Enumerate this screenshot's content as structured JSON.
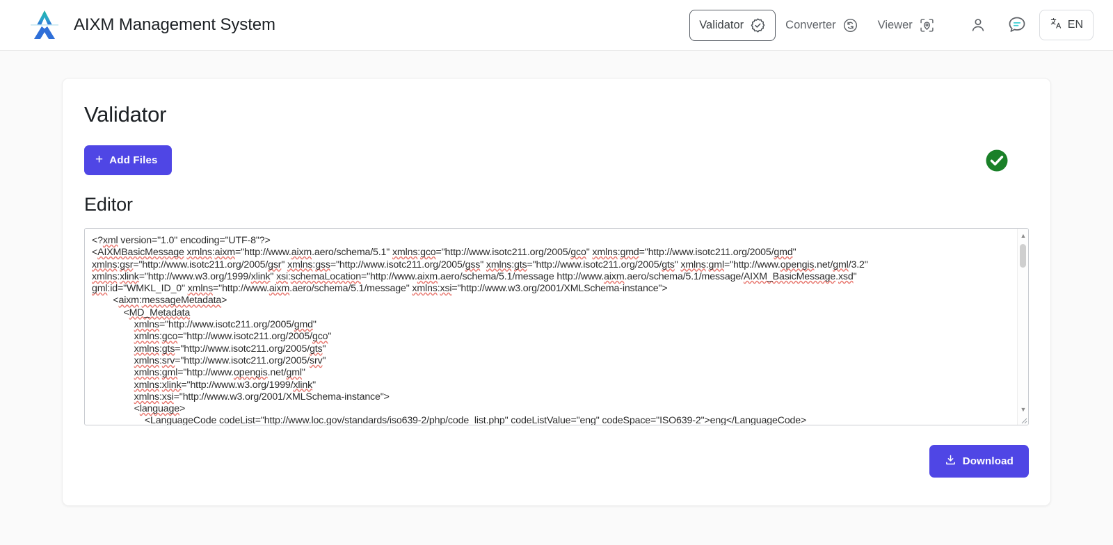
{
  "header": {
    "logo_icon": "aixm-logo-icon",
    "title": "AIXM Management System",
    "nav": [
      {
        "label": "Validator",
        "icon": "badge-check-icon",
        "active": true
      },
      {
        "label": "Converter",
        "icon": "refresh-circle-icon",
        "active": false
      },
      {
        "label": "Viewer",
        "icon": "map-pin-scan-icon",
        "active": false
      }
    ],
    "account_icon": "user-account-icon",
    "chat_icon": "chat-bubble-icon",
    "language": {
      "icon": "translate-icon",
      "label": "EN"
    }
  },
  "main": {
    "page_title": "Validator",
    "add_files_label": "Add Files",
    "add_files_icon": "plus-icon",
    "status_icon": "validation-success-check-icon",
    "status_color": "#1a8028",
    "editor_section_title": "Editor",
    "download_label": "Download",
    "download_icon": "download-icon",
    "accent_color": "#4f46e5"
  },
  "editor": {
    "content": "<?xml version=\"1.0\" encoding=\"UTF-8\"?>\n<AIXMBasicMessage xmlns:aixm=\"http://www.aixm.aero/schema/5.1\" xmlns:gco=\"http://www.isotc211.org/2005/gco\" xmlns:gmd=\"http://www.isotc211.org/2005/gmd\"\nxmlns:gsr=\"http://www.isotc211.org/2005/gsr\" xmlns:gss=\"http://www.isotc211.org/2005/gss\" xmlns:gts=\"http://www.isotc211.org/2005/gts\" xmlns:gml=\"http://www.opengis.net/gml/3.2\"\nxmlns:xlink=\"http://www.w3.org/1999/xlink\" xsi:schemaLocation=\"http://www.aixm.aero/schema/5.1/message http://www.aixm.aero/schema/5.1/message/AIXM_BasicMessage.xsd\"\ngml:id=\"WMKL_ID_0\" xmlns=\"http://www.aixm.aero/schema/5.1/message\" xmlns:xsi=\"http://www.w3.org/2001/XMLSchema-instance\">\n        <aixm:messageMetadata>\n            <MD_Metadata\n                xmlns=\"http://www.isotc211.org/2005/gmd\"\n                xmlns:gco=\"http://www.isotc211.org/2005/gco\"\n                xmlns:gts=\"http://www.isotc211.org/2005/gts\"\n                xmlns:srv=\"http://www.isotc211.org/2005/srv\"\n                xmlns:gml=\"http://www.opengis.net/gml\"\n                xmlns:xlink=\"http://www.w3.org/1999/xlink\"\n                xmlns:xsi=\"http://www.w3.org/2001/XMLSchema-instance\">\n                <language>\n                    <LanguageCode codeList=\"http://www.loc.gov/standards/iso639-2/php/code_list.php\" codeListValue=\"eng\" codeSpace=\"ISO639-2\">eng</LanguageCode>",
    "scrollbar": {
      "up_arrow": "scroll-up-arrow-icon",
      "down_arrow": "scroll-down-arrow-icon",
      "thumb": "scroll-thumb"
    },
    "resize_handle_icon": "resize-grip-icon"
  }
}
